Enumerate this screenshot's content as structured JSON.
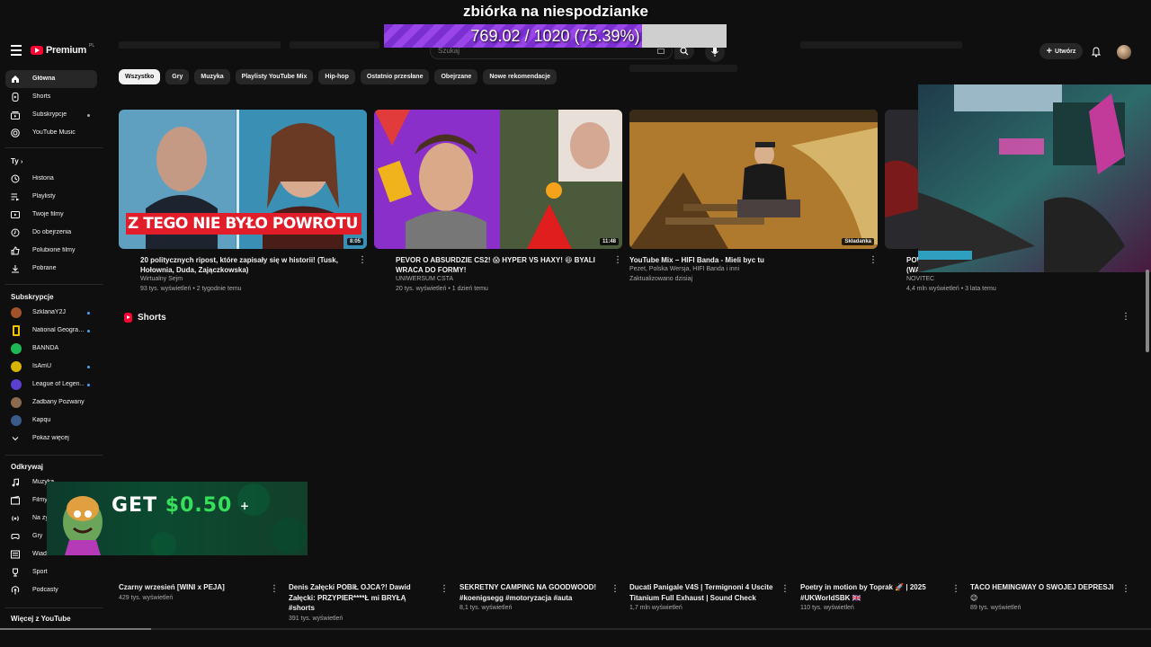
{
  "overlay": {
    "title": "zbiórka na niespodzianke",
    "progress_text": "769.02 / 1020 (75.39%)",
    "progress_fraction": 0.7539
  },
  "header": {
    "logo_text": "Premium",
    "logo_sup": "PL",
    "search_placeholder": "Szukaj",
    "create_label": "Utwórz"
  },
  "sidebar": {
    "main_items": [
      {
        "label": "Główna",
        "icon": "home-icon"
      },
      {
        "label": "Shorts",
        "icon": "shorts-icon"
      },
      {
        "label": "Subskrypcje",
        "icon": "subscriptions-icon"
      },
      {
        "label": "YouTube Music",
        "icon": "music-icon"
      }
    ],
    "you_title": "Ty",
    "you_items": [
      {
        "label": "Historia",
        "icon": "history-icon"
      },
      {
        "label": "Playlisty",
        "icon": "playlist-icon"
      },
      {
        "label": "Twoje filmy",
        "icon": "your-videos-icon"
      },
      {
        "label": "Do obejrzenia",
        "icon": "watch-later-icon"
      },
      {
        "label": "Polubione filmy",
        "icon": "like-icon"
      },
      {
        "label": "Pobrane",
        "icon": "download-icon"
      }
    ],
    "subs_title": "Subskrypcje",
    "subs_items": [
      {
        "label": "SzklanaY2J",
        "color": "#a0522d"
      },
      {
        "label": "National Geogra…",
        "color": "#f2c200"
      },
      {
        "label": "BANNDA",
        "color": "#1db954"
      },
      {
        "label": "IsAmU",
        "color": "#d6b300"
      },
      {
        "label": "League of Legen…",
        "color": "#5a3fd1"
      },
      {
        "label": "Zadbany Pozwany",
        "color": "#8b6b50"
      },
      {
        "label": "Kapqu",
        "color": "#3b5a8a"
      }
    ],
    "show_more": "Pokaż więcej",
    "explore_title": "Odkrywaj",
    "explore_items": [
      {
        "label": "Muzyka",
        "icon": "music-note-icon"
      },
      {
        "label": "Filmy",
        "icon": "film-icon"
      },
      {
        "label": "Na żywo",
        "icon": "live-icon"
      },
      {
        "label": "Gry",
        "icon": "gaming-icon"
      },
      {
        "label": "Wiadomości",
        "icon": "news-icon"
      },
      {
        "label": "Sport",
        "icon": "trophy-icon"
      },
      {
        "label": "Podcasty",
        "icon": "podcast-icon"
      }
    ],
    "more_title": "Więcej z YouTube"
  },
  "chips": [
    "Wszystko",
    "Gry",
    "Muzyka",
    "Playlisty YouTube Mix",
    "Hip-hop",
    "Ostatnio przesłane",
    "Obejrzane",
    "Nowe rekomendacje"
  ],
  "videos": [
    {
      "title": "20 politycznych ripost, które zapisały się w historii! (Tusk, Hołownia, Duda, Zajączkowska)",
      "channel": "Wirtualny Sejm",
      "meta": "93 tys. wyświetleń • 2 tygodnie temu",
      "duration": "8:05",
      "thumb_caption": "Z TEGO NIE BYŁO POWROTU"
    },
    {
      "title": "PEVOR O ABSURDZIE CS2! 😱 HYPER VS HAXY! 😆 BYALI WRACA DO FORMY!",
      "channel": "UNIWERSUM CSTA",
      "meta": "20 tys. wyświetleń • 1 dzień temu",
      "duration": "11:48"
    },
    {
      "title": "YouTube Mix – HIFI Banda - Mieli byc tu",
      "channel": "Pezet, Polska Wersja, HIFI Banda i inni",
      "meta": "Zaktualizowano dzisiaj",
      "duration": "Składanka"
    },
    {
      "title": "POW… (WA…",
      "channel": "NOVITEC",
      "meta": "4,4 mln wyświetleń • 3 lata temu"
    }
  ],
  "shorts": {
    "title": "Shorts",
    "items": [
      {
        "title": "Czarny wrzesień [WINI x PEJA]",
        "views": "429 tys. wyświetleń"
      },
      {
        "title": "Denis Załęcki POBIŁ OJCA?! Dawid Załęcki: PRZYPIER****Ł mi BRYŁĄ #shorts",
        "views": "391 tys. wyświetleń"
      },
      {
        "title": "SEKRETNY CAMPING NA GOODWOOD! #koenigsegg #motoryzacja #auta",
        "views": "8,1 tys. wyświetleń"
      },
      {
        "title": "Ducati Panigale V4S | Termignoni 4 Uscite Titanium Full Exhaust | Sound Check",
        "views": "1,7 mln wyświetleń"
      },
      {
        "title": "Poetry in motion by Toprak 🚀 | 2025 #UKWorldSBK 🇬🇧",
        "views": "110 tys. wyświetleń"
      },
      {
        "title": "TACO HEMINGWAY O SWOJEJ DEPRESJI 😉",
        "views": "89 tys. wyświetleń"
      }
    ]
  },
  "promo": {
    "text_prefix": "GET",
    "text_amount": "$0.50"
  }
}
